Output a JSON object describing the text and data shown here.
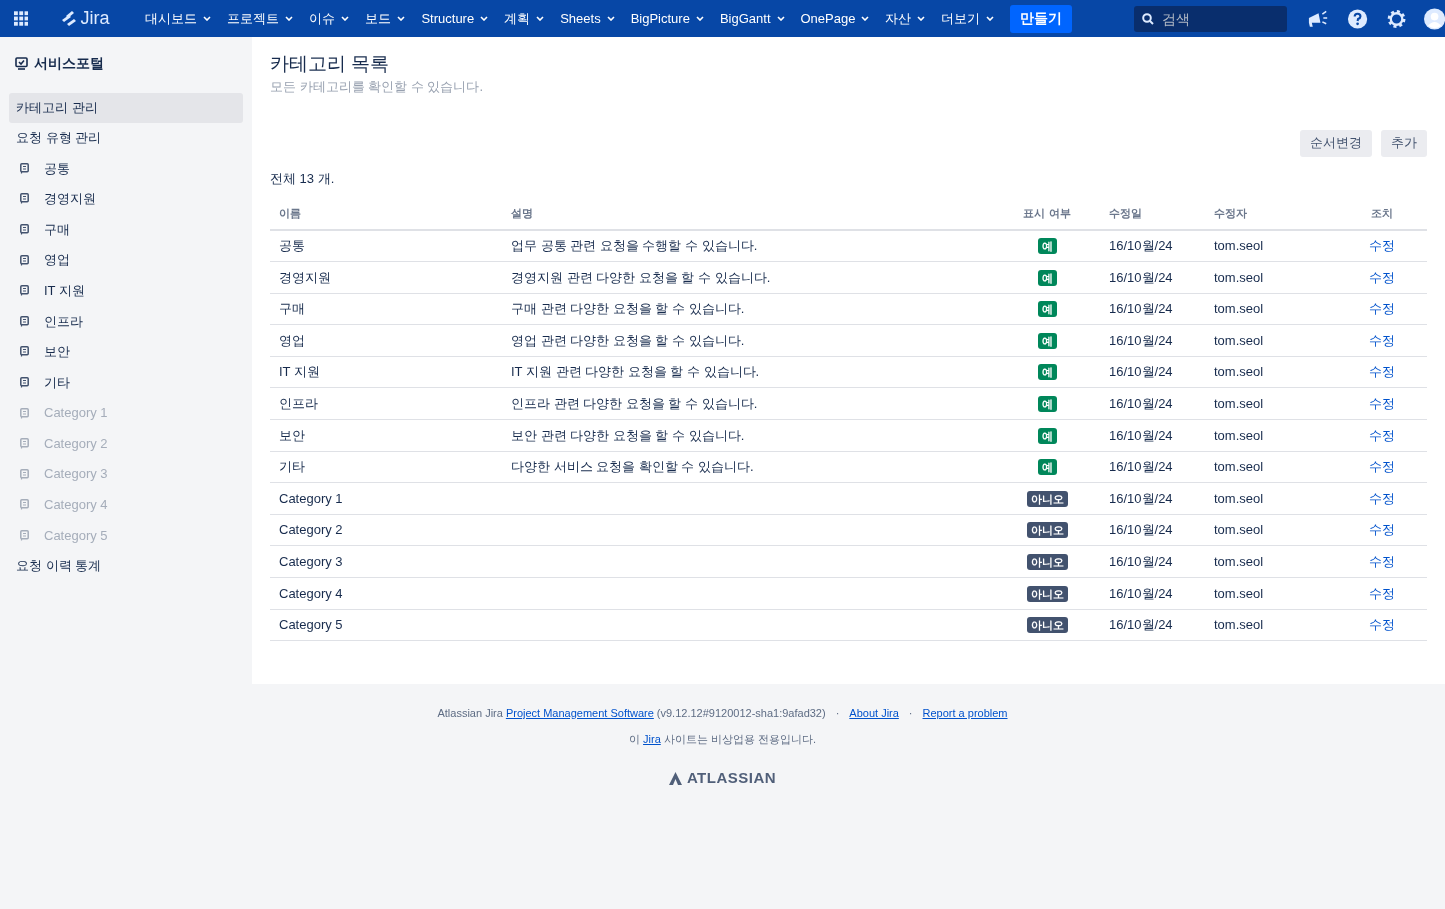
{
  "header": {
    "logo": "Jira",
    "nav": [
      {
        "label": "대시보드"
      },
      {
        "label": "프로젝트"
      },
      {
        "label": "이슈"
      },
      {
        "label": "보드"
      },
      {
        "label": "Structure"
      },
      {
        "label": "계획"
      },
      {
        "label": "Sheets"
      },
      {
        "label": "BigPicture"
      },
      {
        "label": "BigGantt"
      },
      {
        "label": "OnePage"
      },
      {
        "label": "자산"
      },
      {
        "label": "더보기"
      }
    ],
    "create": "만들기",
    "search": {
      "placeholder": "검색"
    }
  },
  "sidebar": {
    "title": "서비스포털",
    "items": [
      {
        "kind": "link",
        "label": "카테고리 관리",
        "selected": true
      },
      {
        "kind": "link",
        "label": "요청 유형 관리",
        "selected": false
      },
      {
        "kind": "category",
        "label": "공통",
        "disabled": false
      },
      {
        "kind": "category",
        "label": "경영지원",
        "disabled": false
      },
      {
        "kind": "category",
        "label": "구매",
        "disabled": false
      },
      {
        "kind": "category",
        "label": "영업",
        "disabled": false
      },
      {
        "kind": "category",
        "label": "IT 지원",
        "disabled": false
      },
      {
        "kind": "category",
        "label": "인프라",
        "disabled": false
      },
      {
        "kind": "category",
        "label": "보안",
        "disabled": false
      },
      {
        "kind": "category",
        "label": "기타",
        "disabled": false
      },
      {
        "kind": "category",
        "label": "Category 1",
        "disabled": true
      },
      {
        "kind": "category",
        "label": "Category 2",
        "disabled": true
      },
      {
        "kind": "category",
        "label": "Category 3",
        "disabled": true
      },
      {
        "kind": "category",
        "label": "Category 4",
        "disabled": true
      },
      {
        "kind": "category",
        "label": "Category 5",
        "disabled": true
      },
      {
        "kind": "link",
        "label": "요청 이력 통계",
        "selected": false
      }
    ]
  },
  "page": {
    "title": "카테고리 목록",
    "subtitle": "모든 카테고리를 확인할 수 있습니다.",
    "buttons": [
      "순서변경",
      "추가"
    ],
    "total": "전체 13 개."
  },
  "table": {
    "columns": [
      "이름",
      "설명",
      "표시 여부",
      "수정일",
      "수정자",
      "조치"
    ],
    "rows": [
      {
        "name": "공통",
        "description": "업무 공통 관련 요청을 수행할 수 있습니다.",
        "display": "예",
        "shown": true,
        "modified": "16/10월/24",
        "modifier": "tom.seol",
        "action": "수정"
      },
      {
        "name": "경영지원",
        "description": "경영지원 관련 다양한 요청을 할 수 있습니다.",
        "display": "예",
        "shown": true,
        "modified": "16/10월/24",
        "modifier": "tom.seol",
        "action": "수정"
      },
      {
        "name": "구매",
        "description": "구매 관련 다양한 요청을 할 수 있습니다.",
        "display": "예",
        "shown": true,
        "modified": "16/10월/24",
        "modifier": "tom.seol",
        "action": "수정"
      },
      {
        "name": "영업",
        "description": "영업 관련 다양한 요청을 할 수 있습니다.",
        "display": "예",
        "shown": true,
        "modified": "16/10월/24",
        "modifier": "tom.seol",
        "action": "수정"
      },
      {
        "name": "IT 지원",
        "description": "IT 지원 관련 다양한 요청을 할 수 있습니다.",
        "display": "예",
        "shown": true,
        "modified": "16/10월/24",
        "modifier": "tom.seol",
        "action": "수정"
      },
      {
        "name": "인프라",
        "description": "인프라 관련 다양한 요청을 할 수 있습니다.",
        "display": "예",
        "shown": true,
        "modified": "16/10월/24",
        "modifier": "tom.seol",
        "action": "수정"
      },
      {
        "name": "보안",
        "description": "보안 관련 다양한 요청을 할 수 있습니다.",
        "display": "예",
        "shown": true,
        "modified": "16/10월/24",
        "modifier": "tom.seol",
        "action": "수정"
      },
      {
        "name": "기타",
        "description": "다양한 서비스 요청을 확인할 수 있습니다.",
        "display": "예",
        "shown": true,
        "modified": "16/10월/24",
        "modifier": "tom.seol",
        "action": "수정"
      },
      {
        "name": "Category 1",
        "display": "아니오",
        "shown": false,
        "modified": "16/10월/24",
        "modifier": "tom.seol",
        "action": "수정"
      },
      {
        "name": "Category 2",
        "display": "아니오",
        "shown": false,
        "modified": "16/10월/24",
        "modifier": "tom.seol",
        "action": "수정"
      },
      {
        "name": "Category 3",
        "display": "아니오",
        "shown": false,
        "modified": "16/10월/24",
        "modifier": "tom.seol",
        "action": "수정"
      },
      {
        "name": "Category 4",
        "display": "아니오",
        "shown": false,
        "modified": "16/10월/24",
        "modifier": "tom.seol",
        "action": "수정"
      },
      {
        "name": "Category 5",
        "display": "아니오",
        "shown": false,
        "modified": "16/10월/24",
        "modifier": "tom.seol",
        "action": "수정"
      }
    ]
  },
  "footer": {
    "product": "Atlassian Jira",
    "product_link": "Project Management Software",
    "version": "(v9.12.12#9120012-sha1:9afad32)",
    "links": [
      {
        "separator": "·",
        "label": "About Jira"
      },
      {
        "separator": "·",
        "label": "Report a problem"
      }
    ],
    "notice_before": "이",
    "notice_link": "Jira",
    "notice_after": "사이트는 비상업용 전용입니다.",
    "logo": "ATLASSIAN"
  }
}
